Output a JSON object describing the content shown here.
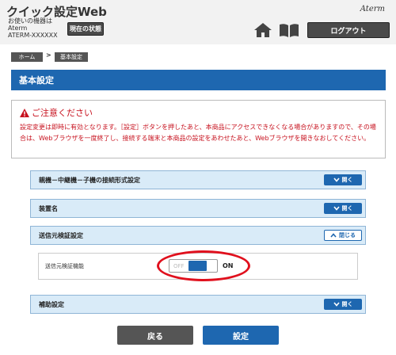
{
  "header": {
    "app_title": "クイック設定Web",
    "device_label": "お使いの機器は",
    "device_name": "Aterm",
    "device_model": "ATERM-XXXXXX",
    "status_button": "現在の状態",
    "brand": "Aterm",
    "logout_button": "ログアウト",
    "icons": [
      "home-icon",
      "book-icon"
    ]
  },
  "breadcrumb": {
    "home": "ホーム",
    "separator": ">",
    "current": "基本設定"
  },
  "page_title": "基本設定",
  "caution": {
    "heading": "ご注意ください",
    "text": "設定変更は即時に有効となります。［設定］ボタンを押したあと、本商品にアクセスできなくなる場合がありますので、その場合は、Webブラウザを一度終了し、接続する端末と本商品の設定をあわせたあと、Webブラウザを開きなおしてください。"
  },
  "sections": [
    {
      "title": "親機－中継機－子機の接続形式設定",
      "button": "開く"
    },
    {
      "title": "装置名",
      "button": "開く"
    },
    {
      "title": "送信元検証設定",
      "button": "閉じる"
    },
    {
      "title": "補助設定",
      "button": "開く"
    }
  ],
  "source_verification": {
    "label": "送信元検証機能",
    "off_label": "OFF",
    "on_label": "ON",
    "state": "ON"
  },
  "buttons": {
    "back": "戻る",
    "submit": "設定"
  },
  "colors": {
    "accent": "#1e67b0",
    "caution": "#c7111e",
    "highlight": "#e0101d",
    "section_bg": "#d9ebf8"
  }
}
